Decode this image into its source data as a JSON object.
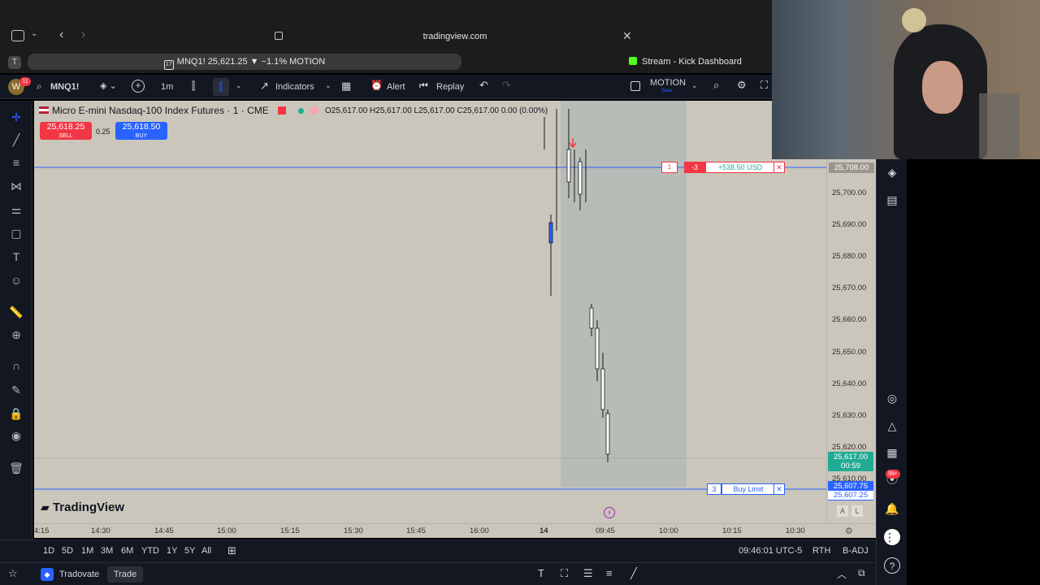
{
  "browser": {
    "url": "tradingview.com",
    "active_tab": "MNQ1! 25,621.25 ▼ −1.1% MOTION",
    "other_tab": "Stream - Kick Dashboard"
  },
  "toolbar": {
    "avatar_letter": "W",
    "avatar_badge": "11",
    "symbol": "MNQ1!",
    "interval": "1m",
    "indicators": "Indicators",
    "alert": "Alert",
    "replay": "Replay",
    "layout_name": "MOTION",
    "layout_status": "Save"
  },
  "legend": {
    "title": "Micro E-mini Nasdaq-100 Index Futures · 1 · CME",
    "ohlc": "O25,617.00  H25,617.00  L25,617.00  C25,617.00  0.00 (0.00%)",
    "sell_price": "25,618.25",
    "sell_label": "SELL",
    "spread": "0.25",
    "buy_price": "25,618.50",
    "buy_label": "BUY"
  },
  "position_line": {
    "qty_left": "1",
    "qty": "-3",
    "pnl": "+538.50 USD",
    "price": "25,708.00"
  },
  "order_line": {
    "qty": "3",
    "label": "Buy Limit",
    "price": "25,607.75",
    "price2": "25,607.25"
  },
  "current_price": {
    "price": "25,617.00",
    "countdown": "00:59"
  },
  "price_scale": [
    "25,700.00",
    "25,690.00",
    "25,680.00",
    "25,670.00",
    "25,660.00",
    "25,650.00",
    "25,640.00",
    "25,630.00",
    "25,620.00"
  ],
  "price_scale_partial": "25,610.00",
  "time_axis": [
    "4:15",
    "14:30",
    "14:45",
    "15:00",
    "15:15",
    "15:30",
    "15:45",
    "16:00",
    "14",
    "09:45",
    "10:00",
    "10:15",
    "10:30"
  ],
  "watermark": "TradingView",
  "scale_buttons": {
    "auto": "A",
    "log": "L"
  },
  "ranges": [
    "1D",
    "5D",
    "1M",
    "3M",
    "6M",
    "YTD",
    "1Y",
    "5Y",
    "All"
  ],
  "bottom_status": {
    "clock": "09:46:01 UTC-5",
    "session": "RTH",
    "adjust": "B-ADJ"
  },
  "broker": {
    "name": "Tradovate",
    "trade": "Trade"
  },
  "rail_badge": "99+",
  "colors": {
    "chart_bg": "#cbc6bb",
    "sell": "#f23645",
    "buy": "#2962ff",
    "position_line": "#2962ff"
  }
}
